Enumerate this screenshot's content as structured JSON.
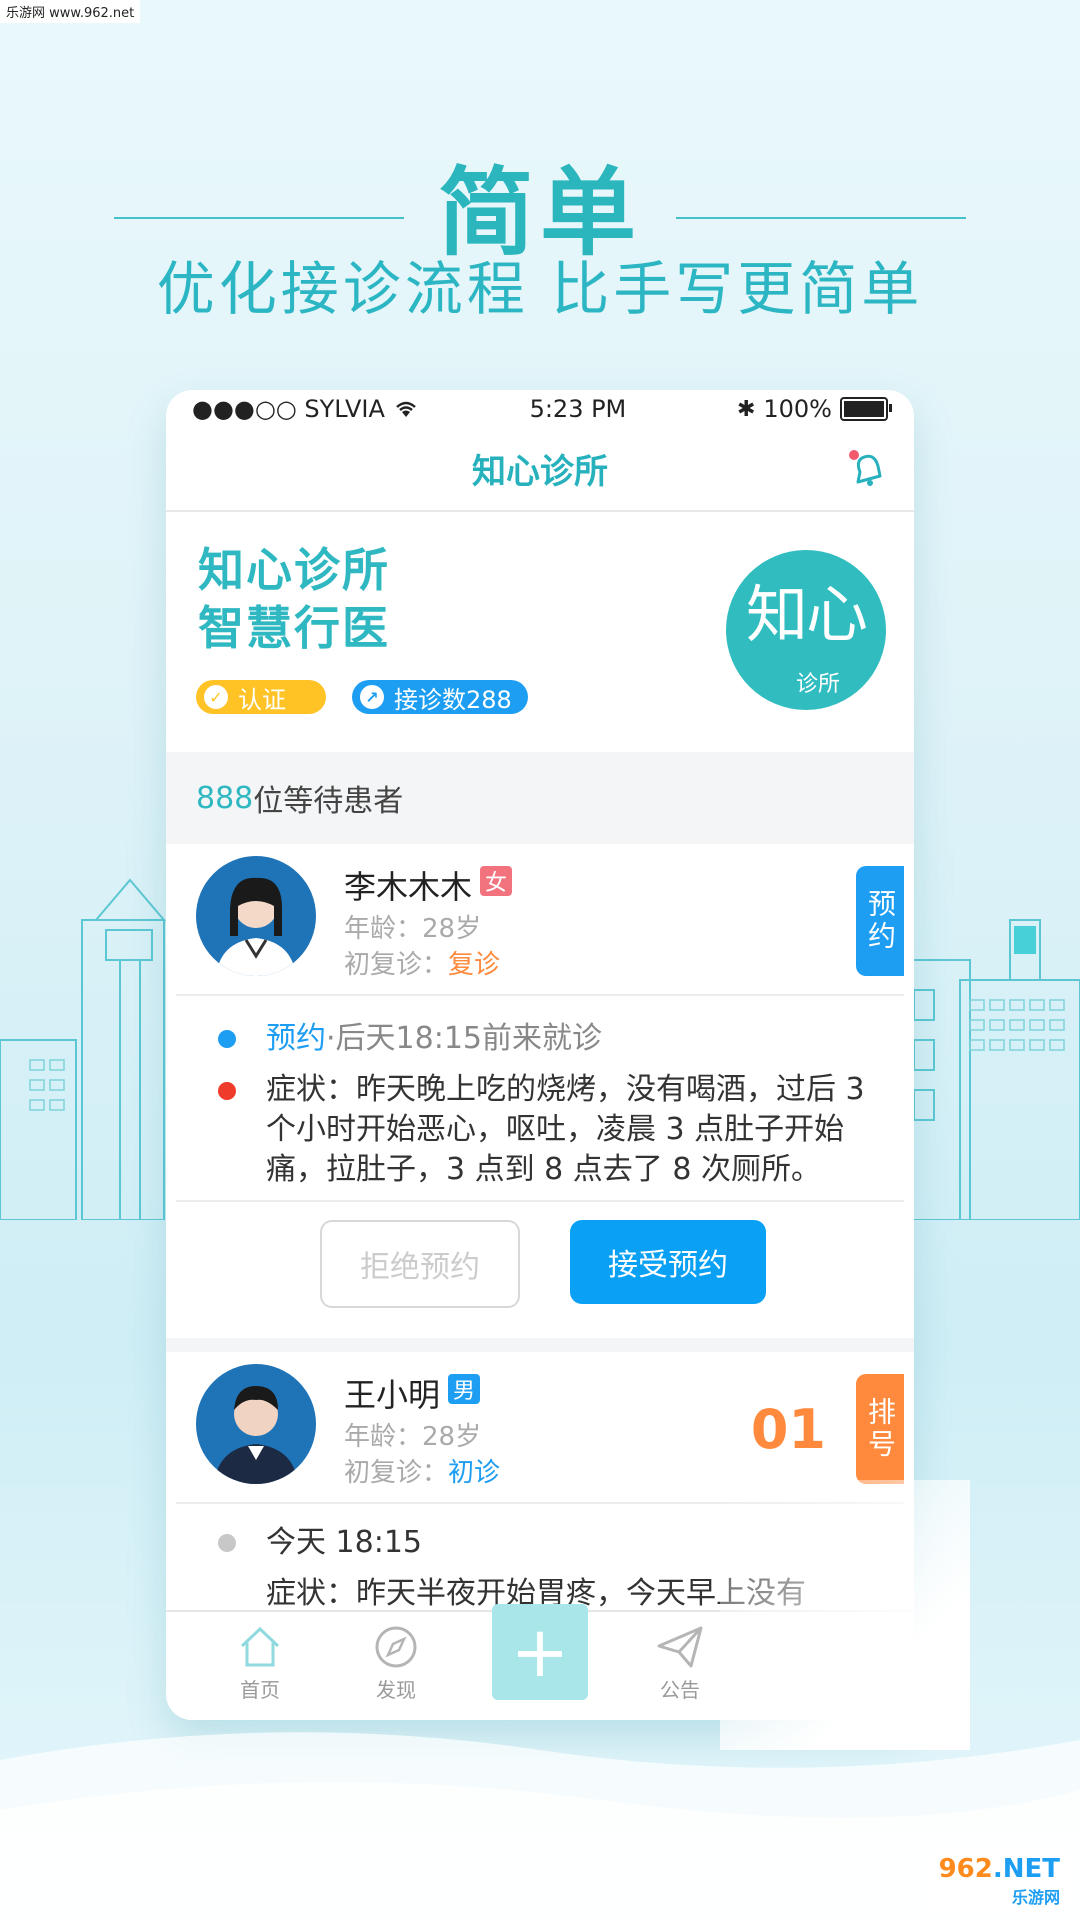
{
  "watermark_top": "乐游网 www.962.net",
  "hero": {
    "title": "简单",
    "subtitle": "优化接诊流程  比手写更简单"
  },
  "status_bar": {
    "carrier": "●●●○○ SYLVIA",
    "time": "5:23 PM",
    "battery": "100%",
    "battery_level": 1.0
  },
  "nav": {
    "title": "知心诊所",
    "bell_icon": "bell-icon"
  },
  "profile": {
    "line1": "知心诊所",
    "line2": "智慧行医",
    "badge_cert": "认证",
    "badge_count": "接诊数288",
    "logo_main": "知心",
    "logo_sub": "诊所"
  },
  "waiting": {
    "count": "888",
    "label": "位等待患者"
  },
  "patients": [
    {
      "name": "李木木木",
      "gender": "女",
      "age_label": "年龄：28岁",
      "visit_label": "初复诊：",
      "visit_value": "复诊",
      "tag": "预约",
      "appt_kw": "预约",
      "appt_text": "·后天18:15前来就诊",
      "symptom": "症状：昨天晚上吃的烧烤，没有喝酒，过后 3 个小时开始恶心，呕吐，凌晨 3 点肚子开始痛，拉肚子，3 点到 8 点去了 8 次厕所。",
      "reject": "拒绝预约",
      "accept": "接受预约"
    },
    {
      "name": "王小明",
      "gender": "男",
      "age_label": "年龄：28岁",
      "visit_label": "初复诊：",
      "visit_value": "初诊",
      "tag": "排号",
      "queue_no": "01",
      "time_text": "今天   18:15",
      "symptom_partial": "症状：昨天半夜开始胃疼，今天早上没有"
    }
  ],
  "tabs": {
    "home": "首页",
    "discover": "发现",
    "add": "+",
    "notice": "公告"
  },
  "watermark_bottom": {
    "a": "962",
    "b": ".NET",
    "c": "乐游网"
  },
  "colors": {
    "teal": "#2fb8c1",
    "blue": "#1e9ef2",
    "orange": "#ff8a3d",
    "yellow": "#ffc326",
    "red": "#ef3b2a"
  }
}
